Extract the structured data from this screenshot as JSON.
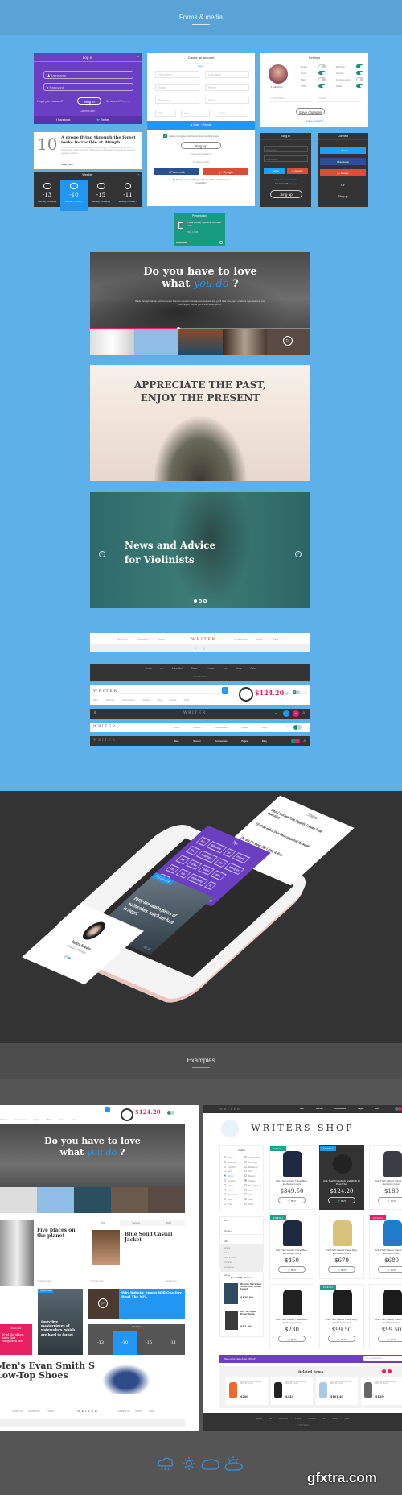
{
  "sections": {
    "forms_media": "Forms & media",
    "examples": "Examples"
  },
  "login_purple": {
    "title": "Log in",
    "username_placeholder": "Username",
    "password_placeholder": "Password",
    "forgot": "Forgot your password?",
    "sign_in": "Sing in",
    "no_account": "No account?",
    "sign_up_link": "Sing up",
    "connect_with": "Connect with:",
    "facebook": "Facebook",
    "twitter": "Twitter"
  },
  "article_card": {
    "number": "10",
    "title": "A drone flying through the forest looks incredible at 80mph",
    "excerpt": "A new trans of the DPV Quadcopter has emerged in the past few years and the footage they produced is nuts. Riders can do things we're fascinated by but can't generally achieve.",
    "read_more": "Read more"
  },
  "weather": {
    "title": "Weather",
    "days": [
      {
        "temp": "-13",
        "unit": "°C",
        "date": "Saturday, February 6",
        "icon": "cloud-sun-icon",
        "active": false
      },
      {
        "temp": "-10",
        "unit": "°C",
        "date": "Saturday, February 7",
        "icon": "cloud-icon",
        "active": true
      },
      {
        "temp": "-15",
        "unit": "°C",
        "date": "Saturday, February 8",
        "icon": "cloud-rain-icon",
        "active": false
      },
      {
        "temp": "-11",
        "unit": "°C",
        "date": "Saturday, February 9",
        "icon": "sun-icon",
        "active": false
      }
    ]
  },
  "create_account": {
    "title": "Create an account",
    "have_account": "If you have an account",
    "log_in": "Log in",
    "fields": [
      "First name",
      "Last name",
      "Email",
      "Phone",
      "Password",
      "Email",
      "DD",
      "MM",
      "YYYY"
    ],
    "gender_male": "Male",
    "gender_female": "Female",
    "agree": "I agree to receive information about exciting offers",
    "sign_up": "Sing up",
    "keep_logged": "Keep me logged in",
    "or_sign_up": "Or sing up with",
    "facebook": "Facebook",
    "google": "Google",
    "terms": "By Signing up you will agree Privacy Policy and Terms of Conditions"
  },
  "settings": {
    "title": "Settings",
    "edit_photo": "Edit photo",
    "toggles_left": [
      {
        "label": "Email",
        "on": false
      },
      {
        "label": "Push",
        "on": true
      },
      {
        "label": "Mail",
        "on": false
      },
      {
        "label": "SMS",
        "on": true
      }
    ],
    "toggles_right": [
      {
        "label": "Birthday",
        "on": true
      },
      {
        "label": "Activity",
        "on": true
      },
      {
        "label": "Compliments",
        "on": false
      },
      {
        "label": "Sales",
        "on": true
      }
    ],
    "first_name": "First name",
    "email": "Email",
    "save": "Save changes",
    "delete": "Delete account?"
  },
  "signin_dark": {
    "title": "Sing in",
    "username": "Username",
    "password": "Password",
    "twitter": "Twitter",
    "google": "Google",
    "forgot": "Forgot your password?",
    "no_account": "No account?",
    "sign_up_link": "Sing up",
    "sign_up": "Sing up"
  },
  "connect_dark": {
    "title": "Connect",
    "twitter": "Twitter",
    "facebook": "Facebook",
    "google": "Google",
    "or": "Or",
    "sign_up": "Sing up"
  },
  "presentation": {
    "title": "Presentation",
    "desc": "Three globally operating business units",
    "size": "PDF, 12 MB",
    "download": "Download"
  },
  "hero_love": {
    "line1": "Do you have to love",
    "line2_a": "what",
    "line2_b": "you do",
    "line2_c": "?",
    "body": "Wade through startup conferences or listen to enough motivational speakers and you'll hear one piece of advice repeated over and over again: You've got to love what you do.",
    "progress": 0.4
  },
  "hero_appreciate": {
    "line1": "APPRECIATE THE PAST,",
    "line2": "ENJOY THE PRESENT"
  },
  "hero_violin": {
    "line1": "News and Advice",
    "line2": "for Violinists",
    "dots": 3,
    "active_dot": 0
  },
  "navbars": {
    "logo": "WRITER",
    "footer_links_left": [
      "About us",
      "Advertise",
      "Press"
    ],
    "footer_links_right": [
      "Contact us",
      "Store",
      "Sale"
    ],
    "dark_links": [
      "About us",
      "Advertise",
      "Press",
      "Contact us",
      "Store",
      "Sale"
    ],
    "copyright": "© 2016 Writer",
    "shop_links": [
      "Men",
      "Women",
      "Accessories",
      "Pages",
      "Blog",
      "News",
      "Sale"
    ],
    "price": "$124.20",
    "badge_count": "8",
    "badge_count2": "10"
  },
  "mockup": {
    "tags_title": "Tags",
    "tags": [
      "love",
      "follow4follow",
      "girl",
      "instagood",
      "food",
      "photooftheday",
      "igers",
      "webstagram",
      "look",
      "fashion",
      "colorful",
      "nofilter",
      "insta",
      "style",
      "photooftheday",
      "tbt",
      "tflers"
    ],
    "all_tags": "All tags",
    "columns_title": "Columns",
    "columns": [
      {
        "title": "What I Learned From Puppets, Lessons From Innovation",
        "author": "Anna Fullerton",
        "role": "Manager"
      },
      {
        "title": "10 of the oldest trees that conquered the world",
        "author": "Kate Wolf",
        "role": "Designer"
      },
      {
        "title": "The Big Lie About The Crime, & Race",
        "author": "Kate Wolf",
        "role": "Designer"
      }
    ],
    "fresh_air": "FRESH AIR",
    "article": "Forty-five masterpieces of watercolors, which are hard to forget",
    "date": "10 Jan 2016",
    "comments": "13",
    "likes": "45",
    "profile_name": "Dmitry Kolodov",
    "profile_role": "Manager of The Studio"
  },
  "example_blog": {
    "tabs": [
      "First",
      "Second",
      "Third"
    ],
    "article1_title": "Five places on the planet",
    "article1_meta": "2 hours ago",
    "article1_comments": "13",
    "article1_likes": "45",
    "article2_title": "Blue Solid Casual Jacket",
    "article2_meta": "1 hour ago",
    "read_more": "Read more",
    "fresh_air": "FRESH AIR",
    "water_article": "Forty-five masterpieces of watercolors, which are hard to forget",
    "robot_title": "Why Robotic Sports Will One Day Rival The NFL",
    "next_post": "Next post",
    "next_text": "10 of the oldest trees that conquered the",
    "shoe_title_1": "Men's Evan Smith S",
    "shoe_title_2": "Low-Top Shoes",
    "footer_links_left": [
      "About us",
      "Advertise",
      "Press"
    ],
    "footer_links_right": [
      "Contact us",
      "Store",
      "Sale"
    ]
  },
  "example_shop": {
    "title": "WRITERS SHOP",
    "nav": [
      "Men",
      "Women",
      "Accessories",
      "Pages",
      "Blog"
    ],
    "colors_title": "Colors",
    "colors_left": [
      "White",
      "Dark Grey",
      "Light Pink",
      "Red",
      "Brown",
      "Emo Lime",
      "Yellow",
      "Green",
      "Black Coral",
      "Blue",
      "Violet"
    ],
    "colors_right": [
      "Shaper Brown",
      "Blue Grey",
      "Blackberry",
      "Teal",
      "Maroon",
      "Orange",
      "Blue (Munsell)",
      "Green",
      "Cyan",
      "Navy",
      "Violet"
    ],
    "categories": [
      "Men",
      "Women",
      "Kids",
      "Stores"
    ],
    "kids_sub": [
      "Jackets",
      "Shoes",
      "Pants & Shorts",
      "Footwear",
      "Accessories"
    ],
    "recently_viewed": "Recently viewed",
    "recent_items": [
      {
        "name": "Browns Marathon Superstore Storm Jacket",
        "price": "$130.00"
      },
      {
        "name": "Rev 1st Rapid Hypertherm",
        "price": "$12.20"
      }
    ],
    "product_name": "Anti-Theft Classic Travel Bag - Exclusive Colors",
    "product_sub": "Exclusive",
    "buy": "BUY",
    "products": [
      {
        "price": "$349.50",
        "fresh": true,
        "color": "#1e2a44",
        "dark": false
      },
      {
        "price": "$124.20",
        "fresh": true,
        "color": "#222",
        "dark": true,
        "name": "Anti-Theft Crossbody and RFID ID Pouch Set"
      },
      {
        "price": "$180",
        "fresh": false,
        "color": "#3b3d44",
        "dark": false
      },
      {
        "price": "$450",
        "fresh": true,
        "color": "#1d2a40",
        "dark": false
      },
      {
        "price": "$679",
        "fresh": false,
        "color": "#d9c27a",
        "dark": false
      },
      {
        "price": "$680",
        "fresh": true,
        "color": "#1f7ccb",
        "dark": false
      },
      {
        "price": "$230",
        "fresh": false,
        "color": "#222",
        "dark": false
      },
      {
        "price": "$99.50",
        "fresh": true,
        "color": "#1e1e1e",
        "dark": false
      },
      {
        "price": "$99.50",
        "fresh": false,
        "color": "#1b1b1b",
        "dark": false
      }
    ],
    "newsletter": "Sign up for news & get 15% off",
    "email_placeholder": "Your email address",
    "related_title": "Related items",
    "related": [
      {
        "name": "Anti-Theft Crossbody and RFID ID Pouch",
        "price": "$200",
        "color": "#f06a2c"
      },
      {
        "name": "Anti-Theft Crossbody and RFID ID Pouch",
        "price": "$343",
        "color": "#222"
      },
      {
        "name": "Anti-Theft Crossbody and RFID ID Pouch",
        "price": "$101.40",
        "color": "#a9cbe6"
      },
      {
        "name": "Anti-Theft Crossbody and RFID ID Pouch",
        "price": "$129",
        "color": "#666"
      }
    ],
    "footer_links": [
      "About us",
      "Advertise",
      "Press",
      "Contact us",
      "Store",
      "Sale"
    ],
    "copyright": "© 2016 Writer"
  },
  "weather_icons": [
    "cloud-rain-icon",
    "sun-icon",
    "cloud-icon",
    "cloud-sun-icon"
  ],
  "watermark": "gfxtra.com",
  "colors": {
    "page_blue": "#5eb0e8",
    "purple": "#6a3fc1",
    "accent_blue": "#2196f3",
    "teal": "#1a8f76",
    "pink": "#e91e63",
    "dark": "#333333",
    "facebook": "#2c4f8f",
    "google": "#dd4b39",
    "twitter": "#1da1f2"
  }
}
